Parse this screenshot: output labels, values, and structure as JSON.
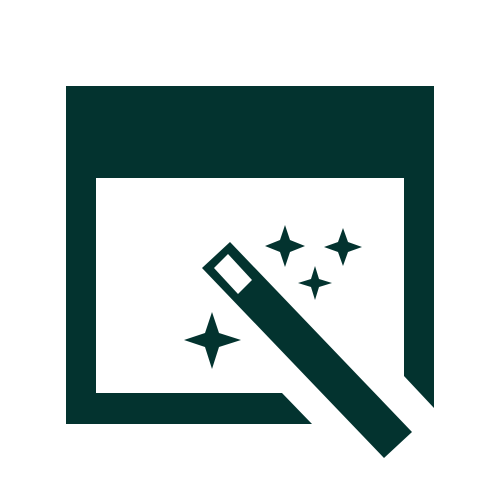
{
  "icon": {
    "name": "browser-window-magic-wand-icon",
    "parts": [
      "browser-window-icon",
      "magic-wand-icon",
      "sparkle-icon"
    ]
  },
  "colors": {
    "foreground": "#03332f",
    "background": "#ffffff"
  }
}
